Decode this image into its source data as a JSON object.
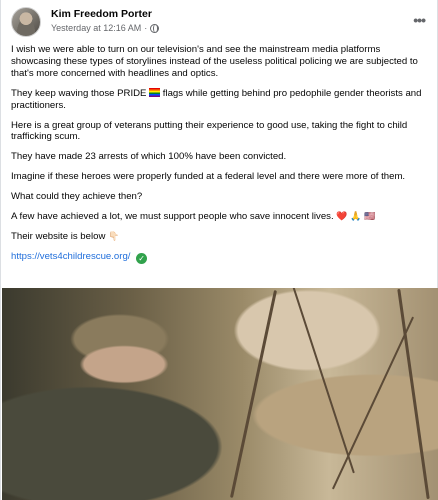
{
  "post": {
    "author": "Kim Freedom Porter",
    "timestamp": "Yesterday at 12:16 AM",
    "separator": "·",
    "more_label": "•••",
    "paragraphs": {
      "p1": "I wish we were able to turn on our television's and see the mainstream media platforms showcasing these types of storylines instead of the useless political policing we are subjected to that's more concerned with headlines and optics.",
      "p2a": "They keep waving those PRIDE",
      "p2b": "flags while getting behind pro pedophile gender theorists and practitioners.",
      "p3": "Here is a great group of veterans putting their experience to good use, taking the fight to child trafficking scum.",
      "p4": "They have made 23 arrests of which 100% have been convicted.",
      "p5": "Imagine if these heroes were properly funded at a federal level and there were more of them.",
      "p6": "What could they achieve then?",
      "p7": "A few have achieved a lot, we must support people who save innocent lives.",
      "p7_emojis": {
        "heart": "❤️",
        "pray": "🙏",
        "flag": "🇺🇸"
      },
      "p8": "Their website is below",
      "p8_emoji": "👇🏻"
    },
    "link": "https://vets4childrescue.org/",
    "verified_symbol": "✓"
  },
  "icons": {
    "globe": "globe-icon",
    "more": "more-options-icon",
    "verified": "check-circle-icon"
  },
  "colors": {
    "link": "#216fdb",
    "meta": "#65676b",
    "verified": "#31a24c"
  }
}
